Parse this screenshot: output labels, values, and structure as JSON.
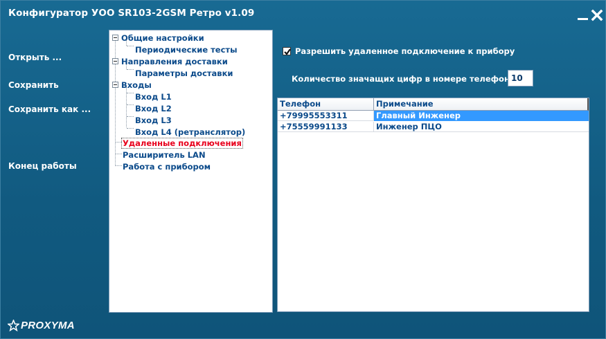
{
  "window": {
    "title": "Конфигуратор УОО SR103-2GSM Ретро v1.09"
  },
  "colors": {
    "background": "#186a93",
    "accent_text": "#0b4a8a",
    "selected_node": "#e8001c",
    "row_highlight": "#3399ff"
  },
  "menu": {
    "open": "Открыть ...",
    "save": "Сохранить",
    "save_as": "Сохранить как ...",
    "exit": "Конец  работы"
  },
  "tree": {
    "general": "Общие настройки",
    "periodic_tests": "Периодические тесты",
    "delivery_directions": "Направления доставки",
    "delivery_params": "Параметры доставки",
    "inputs": "Входы",
    "input_l1": "Вход L1",
    "input_l2": "Вход L2",
    "input_l3": "Вход L3",
    "input_l4": "Вход L4 (ретранслятор)",
    "remote": "Удаленные подключения",
    "lan": "Расширитель LAN",
    "device": "Работа с прибором"
  },
  "content": {
    "allow_remote_label": "Разрешить удаленное подключение к прибору",
    "allow_remote_checked": true,
    "digits_label": "Количество значащих цифр в номере телефона:",
    "digits_value": "10"
  },
  "table": {
    "columns": [
      "Телефон",
      "Примечание"
    ],
    "rows": [
      {
        "phone": "+79995553311",
        "note": "Главный Инженер",
        "selected": true
      },
      {
        "phone": "+75559991133",
        "note": "Инженер ПЦО",
        "selected": false
      }
    ]
  },
  "footer": {
    "logo_text": "PROXYMA",
    "logo_icon": "star-icon"
  }
}
